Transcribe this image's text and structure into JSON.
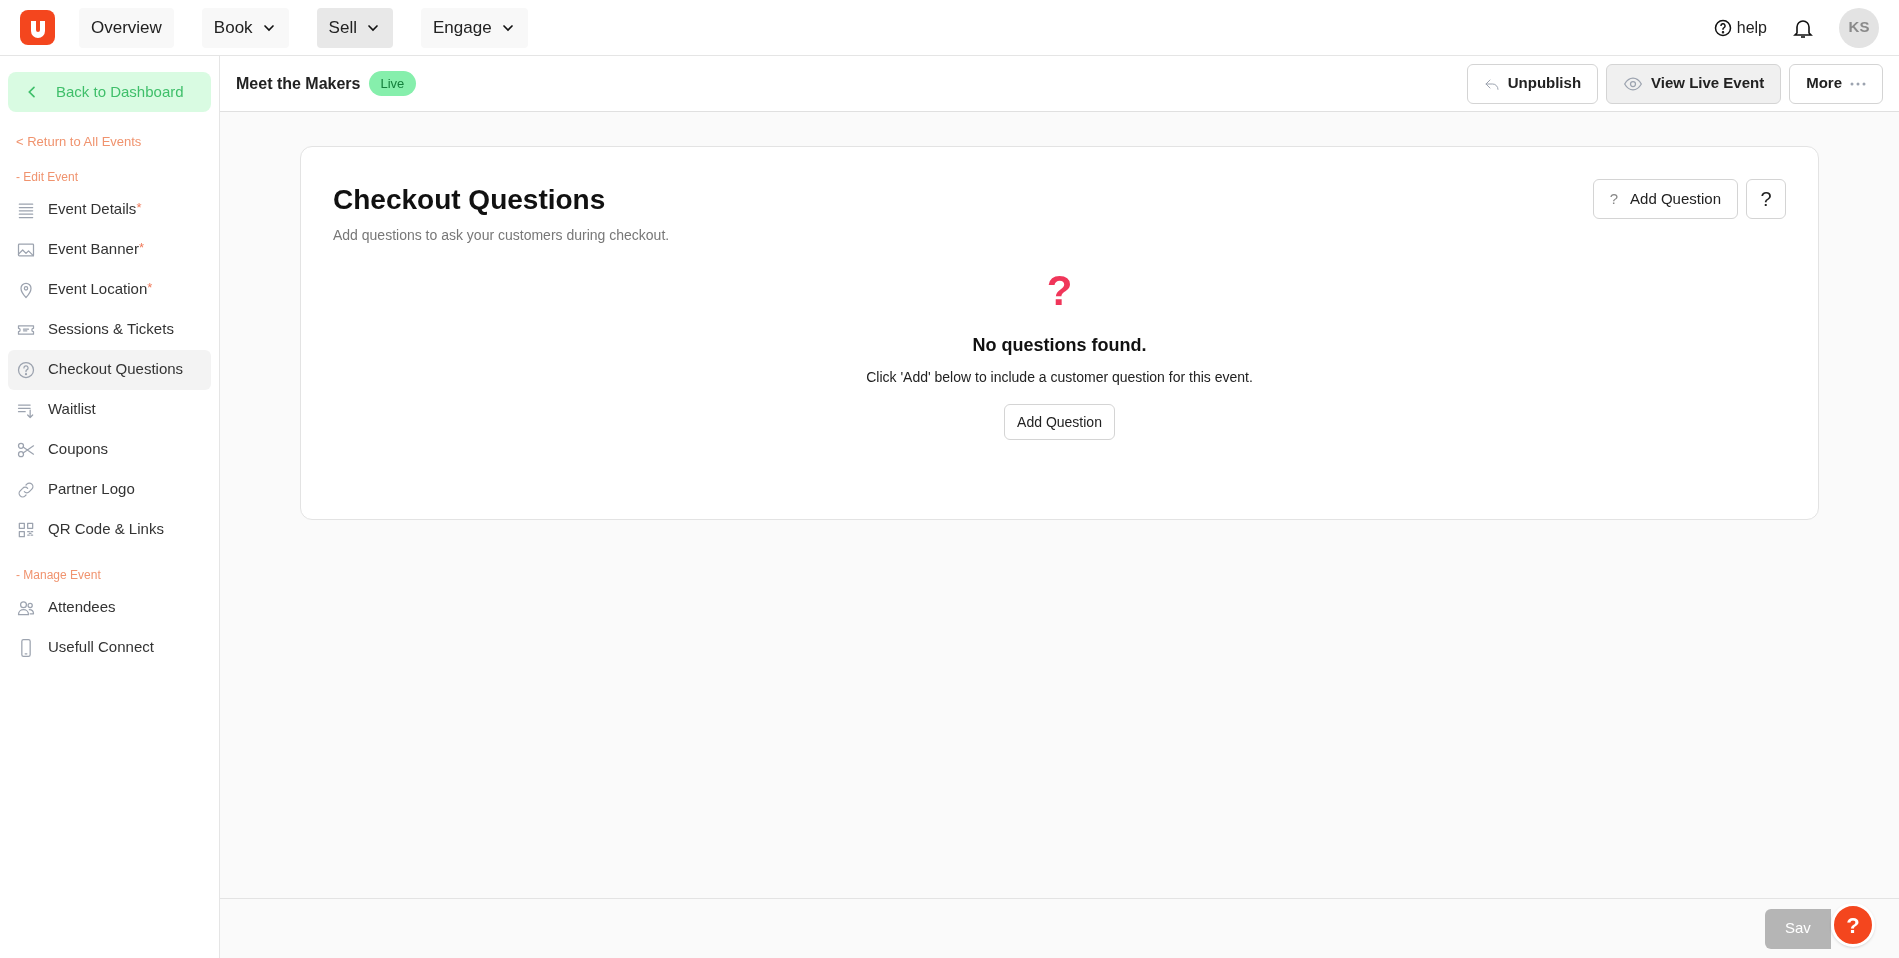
{
  "nav": [
    {
      "label": "Overview",
      "dropdown": false,
      "selected": false
    },
    {
      "label": "Book",
      "dropdown": true,
      "selected": false
    },
    {
      "label": "Sell",
      "dropdown": true,
      "selected": true
    },
    {
      "label": "Engage",
      "dropdown": true,
      "selected": false
    }
  ],
  "top_right": {
    "help": "help",
    "avatar": "KS"
  },
  "sidebar": {
    "back": "Back to Dashboard",
    "required_mark": "*",
    "return_link": "< Return to All Events",
    "sections": [
      {
        "title": "- Edit Event",
        "items": [
          {
            "label": "Event Details",
            "required": true,
            "selected": false
          },
          {
            "label": "Event Banner",
            "required": true,
            "selected": false
          },
          {
            "label": "Event Location",
            "required": true,
            "selected": false
          },
          {
            "label": "Sessions & Tickets",
            "required": false,
            "selected": false
          },
          {
            "label": "Checkout Questions",
            "required": false,
            "selected": true
          },
          {
            "label": "Waitlist",
            "required": false,
            "selected": false
          },
          {
            "label": "Coupons",
            "required": false,
            "selected": false
          },
          {
            "label": "Partner Logo",
            "required": false,
            "selected": false
          },
          {
            "label": "QR Code & Links",
            "required": false,
            "selected": false
          }
        ]
      },
      {
        "title": "- Manage Event",
        "items": [
          {
            "label": "Attendees",
            "required": false,
            "selected": false
          },
          {
            "label": "Usefull Connect",
            "required": false,
            "selected": false
          }
        ]
      }
    ]
  },
  "event_header": {
    "title": "Meet the Makers",
    "status": "Live",
    "actions": [
      "Unpublish",
      "View Live Event",
      "More"
    ]
  },
  "card": {
    "title": "Checkout Questions",
    "subtitle": "Add questions to ask your customers during checkout.",
    "add_button": "Add Question",
    "help_button": "?",
    "empty": {
      "icon": "?",
      "title": "No questions found.",
      "message": "Click 'Add' below to include a customer question for this event.",
      "button": "Add Question"
    }
  },
  "footer": {
    "save": "Sav",
    "save_disabled": true,
    "help_bubble": "?"
  }
}
